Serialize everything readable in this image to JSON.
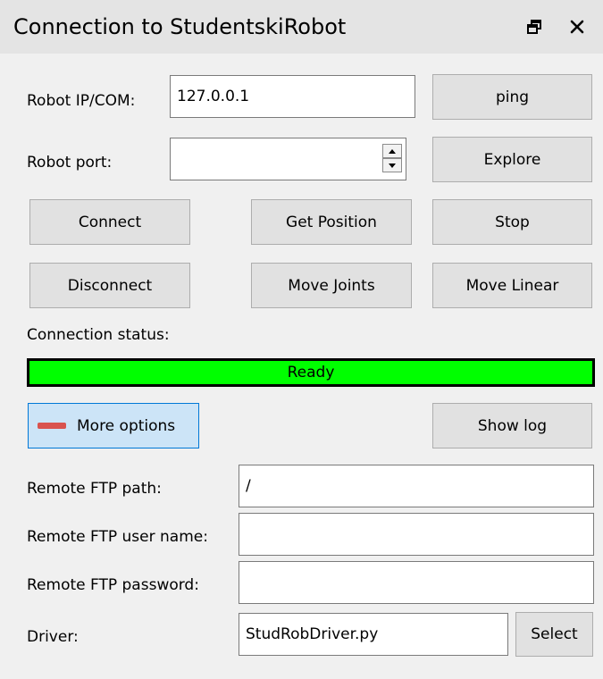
{
  "window": {
    "title": "Connection to StudentskiRobot",
    "float_icon": "float-window-icon",
    "close_icon": "close-icon"
  },
  "robot": {
    "ip_label": "Robot IP/COM:",
    "ip_value": "127.0.0.1",
    "port_label": "Robot port:",
    "port_value": ""
  },
  "buttons": {
    "ping": "ping",
    "explore": "Explore",
    "connect": "Connect",
    "get_position": "Get Position",
    "stop": "Stop",
    "disconnect": "Disconnect",
    "move_joints": "Move Joints",
    "move_linear": "Move Linear",
    "more_options": "More options",
    "show_log": "Show log",
    "select": "Select"
  },
  "status": {
    "label": "Connection status:",
    "value": "Ready",
    "color": "#00ff00"
  },
  "ftp": {
    "path_label": "Remote FTP path:",
    "path_value": "/",
    "user_label": "Remote FTP user name:",
    "user_value": "",
    "password_label": "Remote FTP password:",
    "password_value": ""
  },
  "driver": {
    "label": "Driver:",
    "value": "StudRobDriver.py"
  },
  "colors": {
    "accent": "#0078d7",
    "more_options_icon": "#d9534f"
  }
}
